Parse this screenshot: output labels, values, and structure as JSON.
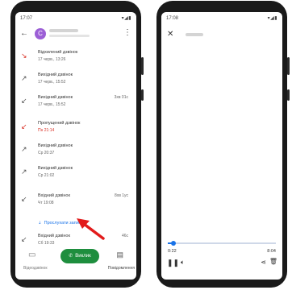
{
  "left_phone": {
    "status_bar": {
      "time": "17:07",
      "icons": "▾◢▮"
    },
    "header": {
      "avatar_letter": "C",
      "more_icon": "⋮",
      "back_icon": "←"
    },
    "calls": [
      {
        "title": "Відхилений дзвінок",
        "sub": "17 черв., 13:26",
        "duration": "",
        "arrow": "↘",
        "missed": false,
        "rejected": true
      },
      {
        "title": "Вихідний дзвінок",
        "sub": "17 черв., 15:52",
        "duration": "",
        "arrow": "↗",
        "missed": false
      },
      {
        "title": "Вихідний дзвінок",
        "sub": "17 черв., 15:52",
        "duration": "3хв 01с",
        "arrow": "↙",
        "missed": false
      },
      {
        "title": "Пропущений дзвінок",
        "sub": "Пн 21:14",
        "duration": "",
        "arrow": "↙",
        "missed": true
      },
      {
        "title": "Вихідний дзвінок",
        "sub": "Ср 20:37",
        "duration": "",
        "arrow": "↗",
        "missed": false
      },
      {
        "title": "Вихідний дзвінок",
        "sub": "Ср 21:02",
        "duration": "",
        "arrow": "↗",
        "missed": false
      },
      {
        "title": "Вхідний дзвінок",
        "sub": "Чт 19:08",
        "duration": "8хв 1ус",
        "arrow": "↙",
        "missed": false
      },
      {
        "title": "Вхідний дзвінок",
        "sub": "Сб 19:33",
        "duration": "46с",
        "arrow": "↙",
        "missed": false
      }
    ],
    "listen_link": "Прослухати запис",
    "actions": {
      "video_label": "Відеодзвінок",
      "call_label": "Виклик",
      "message_label": "Повідомлення"
    }
  },
  "right_phone": {
    "status_bar": {
      "time": "17:08",
      "icons": "▾◢▮"
    },
    "player": {
      "current_time": "0:22",
      "total_time": "8:04",
      "progress": 0.05
    }
  },
  "colors": {
    "accent": "#1a73e8",
    "call_green": "#1e8e3e",
    "missed_red": "#d93025",
    "annotation_red": "#e21b1b"
  }
}
